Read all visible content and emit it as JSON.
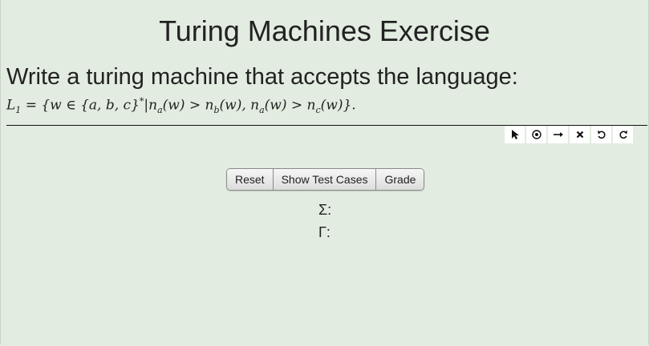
{
  "page": {
    "title": "Turing Machines Exercise",
    "prompt": "Write a turing machine that accepts the language:"
  },
  "language": {
    "L": "L",
    "L_sub": "1",
    "eq": " = {w ∈ {a, b, c}",
    "star": "*",
    "bar": "|n",
    "a1": "a",
    "w1": "(w) > n",
    "b1": "b",
    "w2": "(w), n",
    "a2": "a",
    "w3": "(w) > n",
    "c1": "c",
    "end": "(w)}."
  },
  "toolbar": {
    "tools": [
      {
        "name": "select-tool",
        "icon": "pointer-icon"
      },
      {
        "name": "add-state-tool",
        "icon": "state-circle-icon"
      },
      {
        "name": "add-transition-tool",
        "icon": "arrow-right-icon"
      },
      {
        "name": "delete-tool",
        "icon": "close-icon"
      },
      {
        "name": "undo-tool",
        "icon": "undo-icon"
      },
      {
        "name": "redo-tool",
        "icon": "redo-icon"
      }
    ]
  },
  "buttons": {
    "reset": "Reset",
    "show_test_cases": "Show Test Cases",
    "grade": "Grade"
  },
  "alphabet": {
    "sigma_label": "Σ:",
    "gamma_label": "Γ:"
  }
}
